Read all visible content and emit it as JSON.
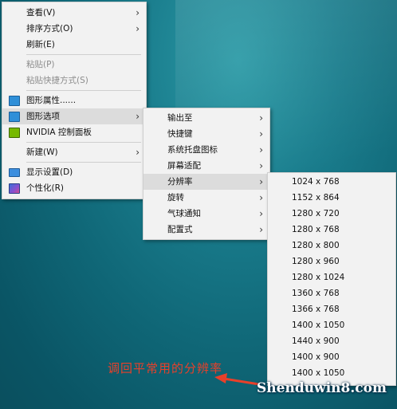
{
  "context_menu": {
    "items": [
      {
        "label": "查看(V)",
        "submenu": true
      },
      {
        "label": "排序方式(O)",
        "submenu": true
      },
      {
        "label": "刷新(E)"
      },
      {
        "label": "粘贴(P)",
        "disabled": true
      },
      {
        "label": "粘贴快捷方式(S)",
        "disabled": true
      },
      {
        "label": "图形属性......",
        "icon": "intel-graphics-icon"
      },
      {
        "label": "图形选项",
        "icon": "intel-graphics-icon",
        "submenu": true
      },
      {
        "label": "NVIDIA 控制面板",
        "icon": "nvidia-icon"
      },
      {
        "label": "新建(W)",
        "submenu": true
      },
      {
        "label": "显示设置(D)",
        "icon": "display-icon"
      },
      {
        "label": "个性化(R)",
        "icon": "personalize-icon"
      }
    ]
  },
  "graphics_submenu": {
    "items": [
      "输出至",
      "快捷键",
      "系统托盘图标",
      "屏幕适配",
      "分辨率",
      "旋转",
      "气球通知",
      "配置式"
    ]
  },
  "resolution_submenu": {
    "items": [
      "1024 x 768",
      "1152 x 864",
      "1280 x 720",
      "1280 x 768",
      "1280 x 800",
      "1280 x 960",
      "1280 x 1024",
      "1360 x 768",
      "1366 x 768",
      "1400 x 1050",
      "1440 x 900",
      "1400 x 900",
      "1400 x 1050"
    ]
  },
  "annotation": {
    "caption": "调回平常用的分辨率",
    "color": "#e8402a"
  },
  "watermark": {
    "text": "Shenduwin8.com"
  },
  "colors": {
    "menu_bg": "#f2f2f2",
    "highlight": "#dcdcdc",
    "desktop": "#1a7d8d"
  }
}
